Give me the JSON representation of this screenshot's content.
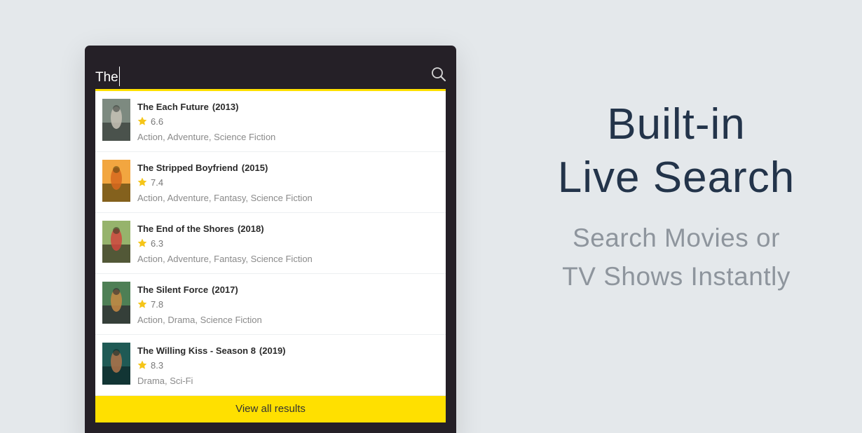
{
  "search": {
    "query": "The"
  },
  "results": [
    {
      "title": "The Each Future",
      "year": "(2013)",
      "rating": "6.6",
      "genres": "Action, Adventure, Science Fiction",
      "colors": [
        "#7d8a80",
        "#c7c2b6",
        "#3a3f3b"
      ]
    },
    {
      "title": "The Stripped Boyfriend",
      "year": "(2015)",
      "rating": "7.4",
      "genres": "Action, Adventure, Fantasy, Science Fiction",
      "colors": [
        "#f2a640",
        "#d7691e",
        "#5f4a12"
      ]
    },
    {
      "title": "The End of the Shores",
      "year": "(2018)",
      "rating": "6.3",
      "genres": "Action, Adventure, Fantasy, Science Fiction",
      "colors": [
        "#96b36c",
        "#d0473e",
        "#3b3a26"
      ]
    },
    {
      "title": "The Silent Force",
      "year": "(2017)",
      "rating": "7.8",
      "genres": "Action, Drama, Science Fiction",
      "colors": [
        "#4e7f55",
        "#c78a44",
        "#2d2a30"
      ]
    },
    {
      "title": "The Willing Kiss - Season 8",
      "year": "(2019)",
      "rating": "8.3",
      "genres": "Drama, Sci-Fi",
      "colors": [
        "#1f5a55",
        "#b0734a",
        "#0f2a2a"
      ]
    }
  ],
  "view_all_label": "View all results",
  "hero": {
    "title_line1": "Built-in",
    "title_line2": "Live Search",
    "subtitle_line1": "Search Movies or",
    "subtitle_line2": "TV Shows Instantly"
  },
  "colors": {
    "accent": "#ffe000",
    "panel": "#252027",
    "background": "#e4e8eb",
    "star": "#f5c518",
    "heading": "#23344a",
    "subheading": "#8e959d"
  },
  "icons": {
    "search": "search-icon",
    "star": "star-icon"
  }
}
